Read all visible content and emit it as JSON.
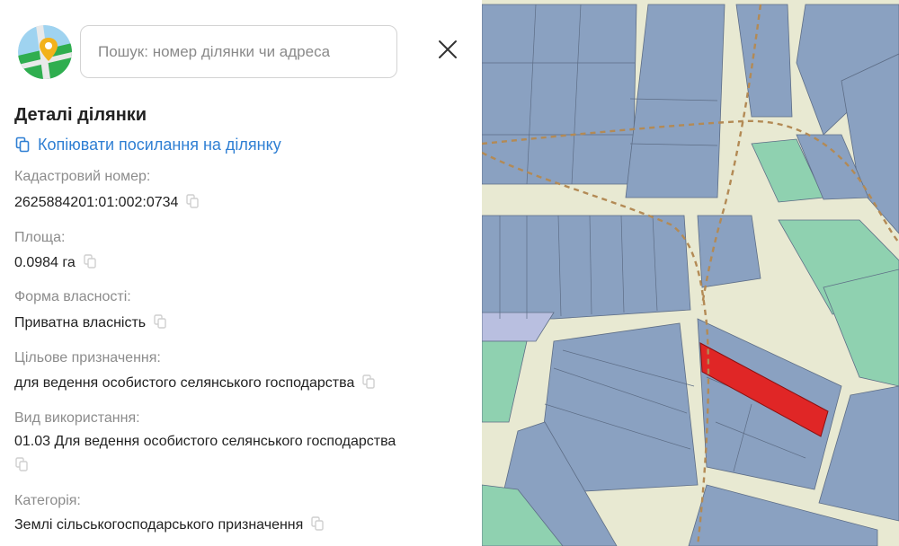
{
  "search": {
    "placeholder": "Пошук: номер ділянки чи адреса"
  },
  "details": {
    "title": "Деталі ділянки",
    "copy_link_label": "Копіювати посилання на ділянку",
    "fields": [
      {
        "label": "Кадастровий номер:",
        "value": "2625884201:01:002:0734"
      },
      {
        "label": "Площа:",
        "value": "0.0984 га"
      },
      {
        "label": "Форма власності:",
        "value": "Приватна власність"
      },
      {
        "label": "Цільове призначення:",
        "value": "для ведення особистого селянського господарства"
      },
      {
        "label": "Вид використання:",
        "value": "01.03 Для ведення особистого селянського господарства"
      },
      {
        "label": "Категорія:",
        "value": "Землі сільськогосподарського призначення"
      }
    ]
  },
  "colors": {
    "link": "#2f7fd3",
    "parcel_fill": "#8aa1c1",
    "selected_parcel": "#e02626",
    "green_parcel": "#8fd1b0",
    "road": "#efefd8",
    "boundary_line": "#b38a55"
  },
  "icons": {
    "logo": "map-pin-logo",
    "close": "close-icon",
    "copy": "copy-icon"
  }
}
